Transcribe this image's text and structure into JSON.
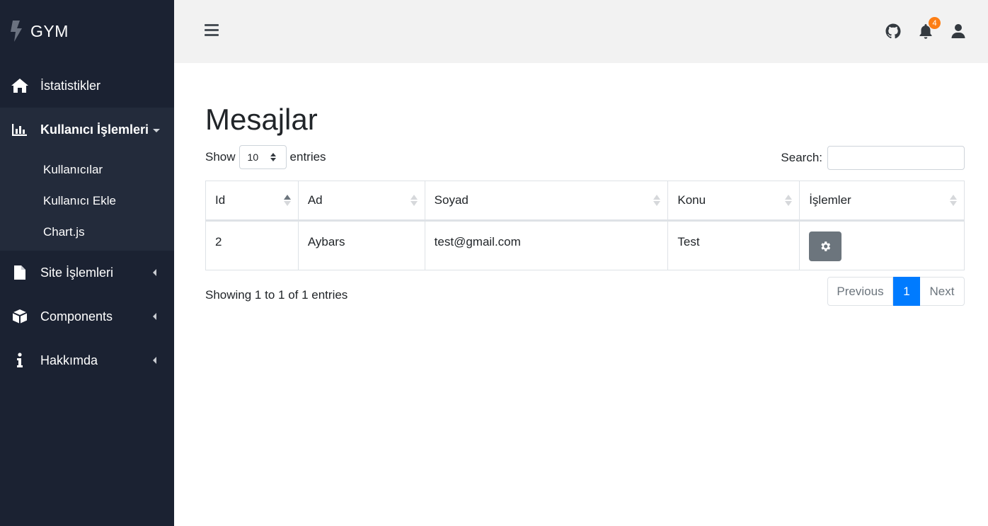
{
  "brand": {
    "name": "GYM"
  },
  "sidebar": {
    "items": [
      {
        "label": "İstatistikler",
        "icon": "home-icon"
      },
      {
        "label": "Kullanıcı İşlemleri",
        "icon": "chart-bar-icon",
        "active": true,
        "children": [
          {
            "label": "Kullanıcılar"
          },
          {
            "label": "Kullanıcı Ekle"
          },
          {
            "label": "Chart.js"
          }
        ]
      },
      {
        "label": "Site İşlemleri",
        "icon": "file-icon"
      },
      {
        "label": "Components",
        "icon": "cube-icon"
      },
      {
        "label": "Hakkımda",
        "icon": "info-icon"
      }
    ]
  },
  "topbar": {
    "notification_count": "4",
    "icons": [
      "bars-icon",
      "github-icon",
      "bell-icon",
      "user-icon"
    ]
  },
  "page": {
    "title": "Mesajlar"
  },
  "table_controls": {
    "show_label": "Show",
    "entries_label": "entries",
    "page_length": "10",
    "search_label": "Search:",
    "search_value": ""
  },
  "table": {
    "columns": [
      "Id",
      "Ad",
      "Soyad",
      "Konu",
      "İşlemler"
    ],
    "rows": [
      {
        "id": "2",
        "ad": "Aybars",
        "soyad": "test@gmail.com",
        "konu": "Test",
        "action_icon": "gear-icon"
      }
    ]
  },
  "pagination": {
    "info": "Showing 1 to 1 of 1 entries",
    "previous": "Previous",
    "current": "1",
    "next": "Next"
  },
  "colors": {
    "sidebar_bg": "#1b2232",
    "sidebar_active_bg": "#232b3b",
    "topbar_bg": "#f2f2f2",
    "primary": "#007bff",
    "badge": "#fd7e14",
    "gear_button": "#6c757d"
  }
}
